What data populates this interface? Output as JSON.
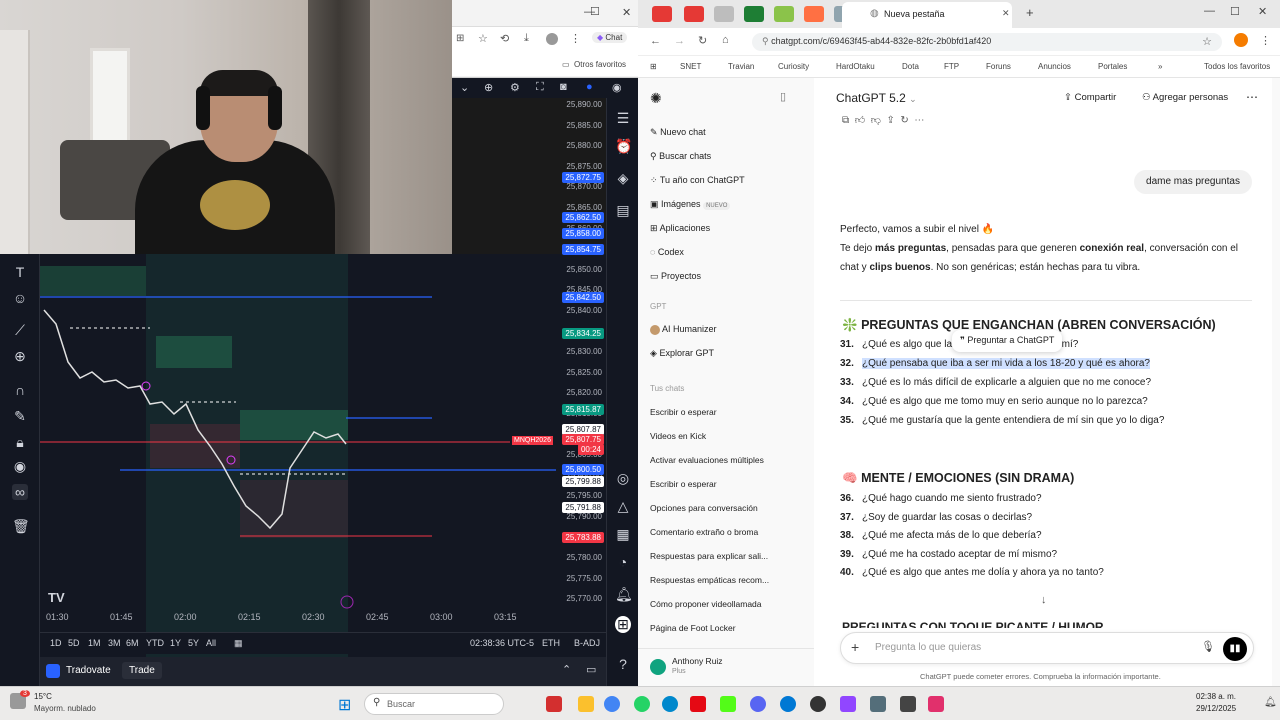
{
  "colors": {
    "chatgpt_accent": "#10a37f",
    "highlight": "#cfe0ff",
    "tv_bg": "#131722",
    "price_red": "#f23645",
    "price_blue": "#2962ff",
    "price_green": "#089981"
  },
  "left_browser": {
    "chat_pill": "Chat",
    "bookmarks_label": "Otros favoritos"
  },
  "chart": {
    "price_labels": [
      "25,890.00",
      "25,885.00",
      "25,880.00",
      "25,875.00",
      "25,870.00",
      "25,865.00",
      "25,860.00",
      "25,855.00",
      "25,850.00",
      "25,845.00",
      "25,840.00",
      "25,835.00",
      "25,830.00",
      "25,825.00",
      "25,820.00",
      "25,815.00",
      "25,810.00",
      "25,805.00",
      "25,800.00",
      "25,795.00",
      "25,790.00",
      "25,785.00",
      "25,780.00",
      "25,775.00",
      "25,770.00"
    ],
    "price_tags": [
      {
        "text": "25,872.75",
        "color": "#2962ff"
      },
      {
        "text": "25,862.50",
        "color": "#2962ff"
      },
      {
        "text": "25,858.00",
        "color": "#2962ff"
      },
      {
        "text": "25,854.75",
        "color": "#2962ff"
      },
      {
        "text": "25,842.50",
        "color": "#2962ff"
      },
      {
        "text": "25,834.25",
        "color": "#089981"
      },
      {
        "text": "25,815.87",
        "color": "#089981"
      },
      {
        "text": "25,807.87",
        "color": "#ffffff"
      },
      {
        "text": "25,807.75",
        "color": "#f23645"
      },
      {
        "text": "00:24",
        "color": "#f23645"
      },
      {
        "text": "25,800.50",
        "color": "#2962ff"
      },
      {
        "text": "25,799.88",
        "color": "#ffffff"
      },
      {
        "text": "25,791.88",
        "color": "#ffffff"
      },
      {
        "text": "25,783.88",
        "color": "#f23645"
      }
    ],
    "symbol_tag": "MNQH2026",
    "time_labels": [
      "01:30",
      "01:45",
      "02:00",
      "02:15",
      "02:30",
      "02:45",
      "03:00",
      "03:15"
    ],
    "ranges": [
      "1D",
      "5D",
      "1M",
      "3M",
      "6M",
      "YTD",
      "1Y",
      "5Y",
      "All"
    ],
    "clock": "02:38:36 UTC-5",
    "exchange": "ETH",
    "adj": "B-ADJ",
    "broker": "Tradovate",
    "trade_button": "Trade"
  },
  "browser": {
    "tab_title": "Nueva pestaña",
    "url": "chatgpt.com/c/69463f45-ab44-832e-82fc-2b0bfd1af420",
    "bookmarks": [
      "SNET",
      "Travian",
      "Curiosity",
      "HardOtaku",
      "Dota",
      "FTP",
      "Foruns",
      "Anuncios",
      "Portales",
      "Todos los favoritos"
    ]
  },
  "sidebar": {
    "items": [
      "Nuevo chat",
      "Buscar chats",
      "Tu año con ChatGPT",
      "Imágenes",
      "Aplicaciones",
      "Codex",
      "Proyectos"
    ],
    "new_badge": "NUEVO",
    "gpt_header": "GPT",
    "gpts": [
      "AI Humanizer",
      "Explorar GPT"
    ],
    "chats_header": "Tus chats",
    "chats": [
      "Escribir o esperar",
      "Videos en Kick",
      "Activar evaluaciones múltiples",
      "Escribir o esperar",
      "Opciones para conversación",
      "Comentario extraño o broma",
      "Respuestas para explicar sali...",
      "Respuestas empáticas recom...",
      "Cómo proponer videollamada",
      "Página de Foot Locker"
    ],
    "user_name": "Anthony Ruiz",
    "user_plan": "Plus"
  },
  "header": {
    "model": "ChatGPT 5.2",
    "share": "Compartir",
    "add_people": "Agregar personas"
  },
  "conversation": {
    "user_bubble": "dame mas preguntas",
    "intro_line1": "Perfecto, vamos a subir el nivel 🔥",
    "intro_line2_a": "Te dejo ",
    "intro_line2_b": "más preguntas",
    "intro_line2_c": ", pensadas para que generen ",
    "intro_line2_d": "conexión real",
    "intro_line2_e": ", conversación con el",
    "intro_line3_a": "chat y ",
    "intro_line3_b": "clips buenos",
    "intro_line3_c": ". No son genéricas; están hechas para tu vibra.",
    "section1_icon": "❇️",
    "section1": "PREGUNTAS QUE ENGANCHAN (ABREN CONVERSACIÓN)",
    "tooltip": "Preguntar a ChatGPT",
    "q31a": "¿Qué es algo que la",
    "q31b": "ar de mí?",
    "q32": "¿Qué pensaba que iba a ser mi vida a los 18-20 y qué es ahora?",
    "q33": "¿Qué es lo más difícil de explicarle a alguien que no me conoce?",
    "q34": "¿Qué es algo que me tomo muy en serio aunque no lo parezca?",
    "q35": "¿Qué me gustaría que la gente entendiera de mí sin que yo lo diga?",
    "section2_icon": "🧠",
    "section2": "MENTE / EMOCIONES (SIN DRAMA)",
    "q36": "¿Qué hago cuando me siento frustrado?",
    "q37": "¿Soy de guardar las cosas o decirlas?",
    "q38": "¿Qué me afecta más de lo que debería?",
    "q39": "¿Qué me ha costado aceptar de mí mismo?",
    "q40": "¿Qué es algo que antes me dolía y ahora ya no tanto?",
    "section3_partial": "PREGUNTAS CON TOQUE PICANTE / HUMOR",
    "nums": [
      "31.",
      "32.",
      "33.",
      "34.",
      "35.",
      "36.",
      "37.",
      "38.",
      "39.",
      "40."
    ]
  },
  "composer": {
    "placeholder": "Pregunta lo que quieras",
    "disclaimer": "ChatGPT puede cometer errores. Comprueba la información importante."
  },
  "taskbar": {
    "temp": "15°C",
    "weather": "Mayorm. nublado",
    "search": "Buscar",
    "time": "02:38 a. m.",
    "date": "29/12/2025",
    "notif_count": "3"
  }
}
